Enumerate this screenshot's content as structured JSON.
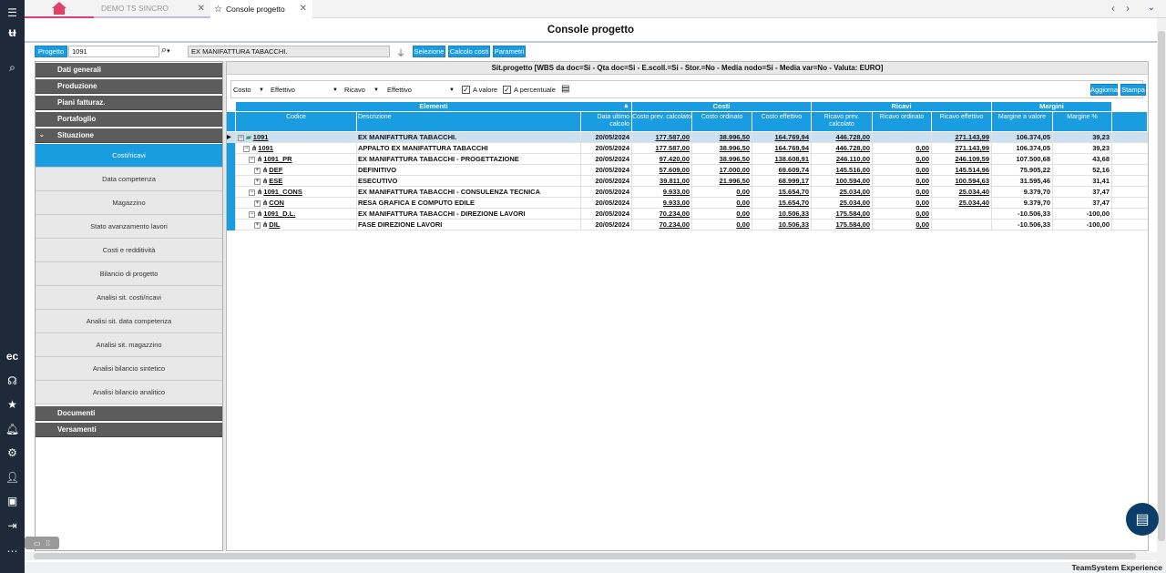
{
  "tabs": [
    {
      "label": ""
    },
    {
      "label": "DEMO TS SINCRO"
    },
    {
      "label": "Console progetto"
    }
  ],
  "page_title": "Console progetto",
  "search": {
    "type_label": "Progetto",
    "code_value": "1091",
    "description_value": "EX MANIFATTURA TABACCHI.",
    "buttons": [
      "Selezione",
      "Calcolo costi",
      "Parametri"
    ]
  },
  "sidebar": {
    "headers_top": [
      "Dati generali",
      "Produzione",
      "Piani fatturaz.",
      "Portafoglio",
      "Situazione"
    ],
    "items": [
      "Costi/ricavi",
      "Data competenza",
      "Magazzino",
      "Stato avanzamento lavori",
      "Costi e redditività",
      "Bilancio di progetto",
      "Analisi sit. costi/ricavi",
      "Analisi sit. data competenza",
      "Analisi sit. magazzino",
      "Analisi bilancio sintetico",
      "Analisi bilancio analitico"
    ],
    "headers_bottom": [
      "Documenti",
      "Versamenti"
    ]
  },
  "main": {
    "header": "Sit.progetto   [WBS da doc=Si - Qta doc=Si - E.scoll.=Si - Stor.=No - Media nodo=Si - Media var=No - Valuta: EURO]",
    "filters": {
      "costo_label": "Costo",
      "costo_value": "Effettivo",
      "ricavo_label": "Ricavo",
      "ricavo_value": "Effettivo",
      "a_valore": "A valore",
      "a_percentuale": "A percentuale"
    },
    "buttons": [
      "Aggiorna",
      "Stampa"
    ]
  },
  "grid": {
    "groups": [
      "Elementi",
      "Costi",
      "Ricavi",
      "Margini"
    ],
    "columns": [
      "Codice",
      "Descrizione",
      "Data ultimo calcolo",
      "Costo prev. calcolato",
      "Costo ordinato",
      "Costo effettivo",
      "Ricavo prev. calcolato",
      "Ricavo ordinato",
      "Ricavo effettivo",
      "Margine a valore",
      "Margine %"
    ],
    "rows": [
      {
        "code": "1091",
        "desc": "EX MANIFATTURA TABACCHI.",
        "date": "20/05/2024",
        "cp": "177.587,00",
        "co": "38.996,50",
        "ce": "164.769,94",
        "rp": "446.728,00",
        "ro": "",
        "re": "271.143,99",
        "mv": "106.374,05",
        "mp": "39,23"
      },
      {
        "code": "1091",
        "desc": "APPALTO EX MANIFATTURA TABACCHI",
        "date": "20/05/2024",
        "cp": "177.587,00",
        "co": "38.996,50",
        "ce": "164.769,94",
        "rp": "446.728,00",
        "ro": "0,00",
        "re": "271.143,99",
        "mv": "106.374,05",
        "mp": "39,23"
      },
      {
        "code": "1091_PR",
        "desc": "EX MANIFATTURA TABACCHI - PROGETTAZIONE",
        "date": "20/05/2024",
        "cp": "97.420,00",
        "co": "38.996,50",
        "ce": "138.608,91",
        "rp": "246.110,00",
        "ro": "0,00",
        "re": "246.109,59",
        "mv": "107.500,68",
        "mp": "43,68"
      },
      {
        "code": "DEF",
        "desc": "DEFINITIVO",
        "date": "20/05/2024",
        "cp": "57.609,00",
        "co": "17.000,00",
        "ce": "69.609,74",
        "rp": "145.516,00",
        "ro": "0,00",
        "re": "145.514,96",
        "mv": "75.905,22",
        "mp": "52,16"
      },
      {
        "code": "ESE",
        "desc": "ESECUTIVO",
        "date": "20/05/2024",
        "cp": "39.811,00",
        "co": "21.996,50",
        "ce": "68.999,17",
        "rp": "100.594,00",
        "ro": "0,00",
        "re": "100.594,63",
        "mv": "31.595,46",
        "mp": "31,41"
      },
      {
        "code": "1091_CONS",
        "desc": "EX MANIFATTURA TABACCHI - CONSULENZA TECNICA",
        "date": "20/05/2024",
        "cp": "9.933,00",
        "co": "0,00",
        "ce": "15.654,70",
        "rp": "25.034,00",
        "ro": "0,00",
        "re": "25.034,40",
        "mv": "9.379,70",
        "mp": "37,47"
      },
      {
        "code": "CON",
        "desc": "RESA GRAFICA E COMPUTO EDILE",
        "date": "20/05/2024",
        "cp": "9.933,00",
        "co": "0,00",
        "ce": "15.654,70",
        "rp": "25.034,00",
        "ro": "0,00",
        "re": "25.034,40",
        "mv": "9.379,70",
        "mp": "37,47"
      },
      {
        "code": "1091_D.L.",
        "desc": "EX MANIFATTURA TABACCHI - DIREZIONE LAVORI",
        "date": "20/05/2024",
        "cp": "70.234,00",
        "co": "0,00",
        "ce": "10.506,33",
        "rp": "175.584,00",
        "ro": "0,00",
        "re": "",
        "mv": "-10.506,33",
        "mp": "-100,00"
      },
      {
        "code": "DIL",
        "desc": "FASE DIREZIONE LAVORI",
        "date": "20/05/2024",
        "cp": "70.234,00",
        "co": "0,00",
        "ce": "10.506,33",
        "rp": "175.584,00",
        "ro": "0,00",
        "re": "",
        "mv": "-10.506,33",
        "mp": "-100,00"
      }
    ]
  },
  "footer": "TeamSystem Experience"
}
